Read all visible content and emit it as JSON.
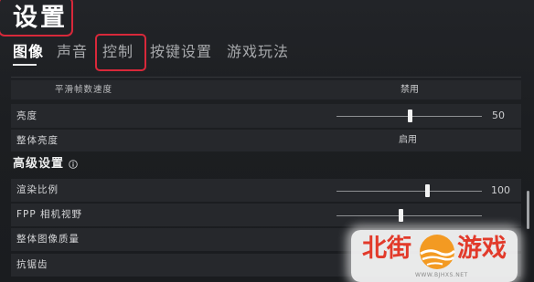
{
  "header": {
    "title": "设置",
    "annotated": true
  },
  "tabs": [
    {
      "label": "图像",
      "active": true,
      "annotated": false
    },
    {
      "label": "声音",
      "active": false,
      "annotated": false
    },
    {
      "label": "控制",
      "active": false,
      "annotated": true
    },
    {
      "label": "按键设置",
      "active": false,
      "annotated": false
    },
    {
      "label": "游戏玩法",
      "active": false,
      "annotated": false
    }
  ],
  "settings": {
    "rows": [
      {
        "label": "平滑帧数速度",
        "value": "禁用"
      },
      {
        "label": "亮度",
        "value": "50",
        "level": 0.5
      },
      {
        "label": "整体亮度",
        "value": "启用"
      }
    ],
    "advanced": {
      "header": "高级设置",
      "header_icon": "info-icon",
      "rows": [
        {
          "label": "渲染比例",
          "value": "100",
          "level": 0.62
        },
        {
          "label": "FPP 相机视野",
          "level": 0.44
        },
        {
          "label": "整体图像质量"
        },
        {
          "label": "抗锯齿"
        }
      ]
    }
  },
  "watermark": {
    "text_left": "北街",
    "text_right": "游戏",
    "url": "WWW.BJHXS.NET",
    "logo_icon": "sun-wave-logo-icon"
  },
  "colors": {
    "bg": "#1c1e21",
    "row": "#26282c",
    "text": "#d4d5d7",
    "muted": "#a7a9ac",
    "annot": "#d8283a",
    "watermark-red": "#e23a2a",
    "watermark-orange": "#f39a22"
  }
}
